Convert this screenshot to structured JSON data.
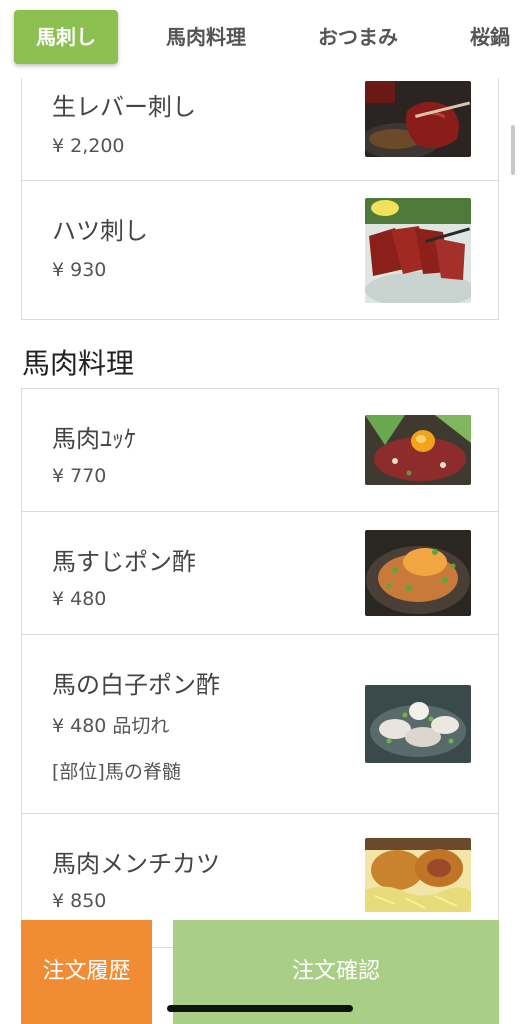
{
  "tabs": [
    {
      "label": "馬刺し",
      "active": true
    },
    {
      "label": "馬肉料理",
      "active": false
    },
    {
      "label": "おつまみ",
      "active": false
    },
    {
      "label": "桜鍋",
      "active": false
    }
  ],
  "sections": [
    {
      "title": "",
      "items": [
        {
          "name": "生レバー刺し",
          "price": "¥ 2,200"
        },
        {
          "name": "ハツ刺し",
          "price": "¥ 930"
        }
      ]
    },
    {
      "title": "馬肉料理",
      "items": [
        {
          "name": "馬肉ﾕｯｹ",
          "price": "¥ 770"
        },
        {
          "name": "馬すじポン酢",
          "price": "¥ 480"
        },
        {
          "name": "馬の白子ポン酢",
          "price": "¥ 480 品切れ",
          "note": "[部位]馬の脊髄"
        },
        {
          "name": "馬肉メンチカツ",
          "price": "¥ 850"
        }
      ]
    }
  ],
  "footer": {
    "history_label": "注文履歴",
    "confirm_label": "注文確認"
  },
  "colors": {
    "tab_active": "#8cc152",
    "history_button": "#f08c34",
    "confirm_button": "#a9cf86"
  }
}
